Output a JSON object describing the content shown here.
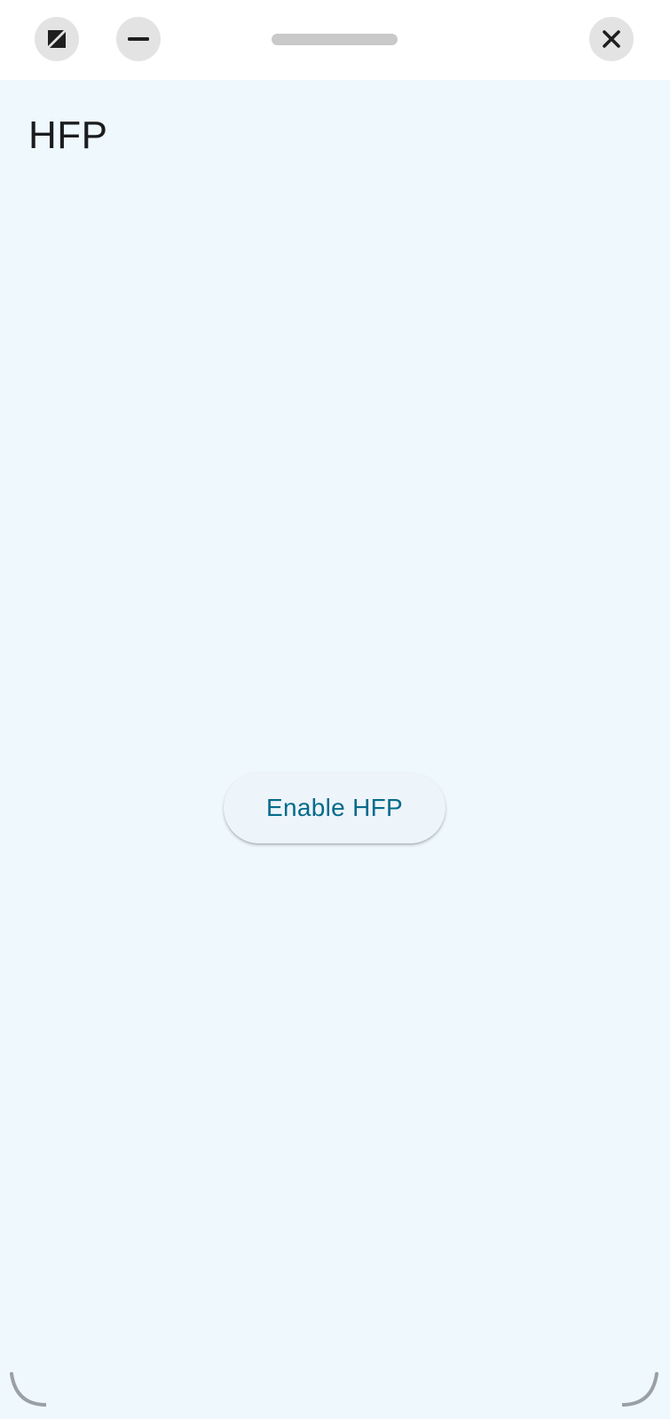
{
  "caption_bar": {
    "resize_icon": "resize-icon",
    "minimize_icon": "minimize-icon",
    "close_icon": "close-icon",
    "button_background": "#e3e3e3",
    "handle_color": "#c9c9c9"
  },
  "page": {
    "title": "HFP",
    "background": "#eff8fc"
  },
  "actions": {
    "enable_label": "Enable HFP",
    "enable_color": "#046b8a"
  }
}
